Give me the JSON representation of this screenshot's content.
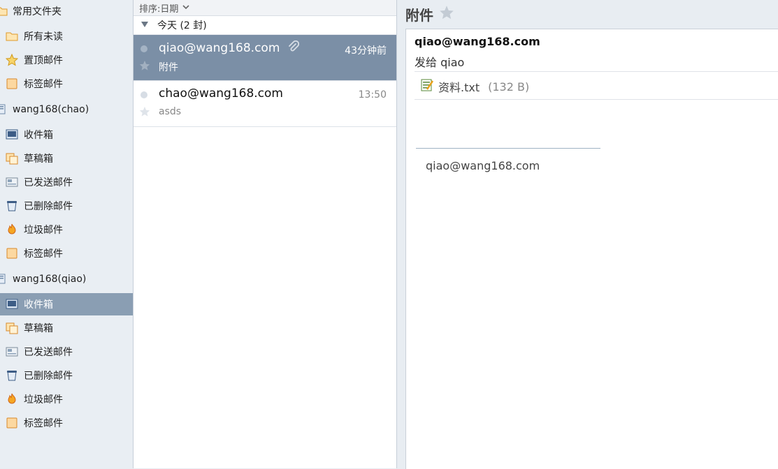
{
  "sidebar": {
    "items": [
      {
        "label": "常用文件夹",
        "icon": "folder-icon",
        "kind": "group"
      },
      {
        "label": "所有未读",
        "icon": "folder-icon",
        "kind": "item"
      },
      {
        "label": "置顶邮件",
        "icon": "star-icon",
        "kind": "item"
      },
      {
        "label": "标签邮件",
        "icon": "tag-icon",
        "kind": "item"
      },
      {
        "label": "wang168(chao)",
        "icon": "account-icon",
        "kind": "group"
      },
      {
        "label": "收件箱",
        "icon": "inbox-icon",
        "kind": "item"
      },
      {
        "label": "草稿箱",
        "icon": "drafts-icon",
        "kind": "item"
      },
      {
        "label": "已发送邮件",
        "icon": "sent-icon",
        "kind": "item"
      },
      {
        "label": "已删除邮件",
        "icon": "trash-icon",
        "kind": "item"
      },
      {
        "label": "垃圾邮件",
        "icon": "spam-icon",
        "kind": "item"
      },
      {
        "label": "标签邮件",
        "icon": "tag-icon",
        "kind": "item"
      },
      {
        "label": "wang168(qiao)",
        "icon": "account-icon",
        "kind": "group"
      },
      {
        "label": "收件箱",
        "icon": "inbox-icon",
        "kind": "item",
        "selected": true
      },
      {
        "label": "草稿箱",
        "icon": "drafts-icon",
        "kind": "item"
      },
      {
        "label": "已发送邮件",
        "icon": "sent-icon",
        "kind": "item"
      },
      {
        "label": "已删除邮件",
        "icon": "trash-icon",
        "kind": "item"
      },
      {
        "label": "垃圾邮件",
        "icon": "spam-icon",
        "kind": "item"
      },
      {
        "label": "标签邮件",
        "icon": "tag-icon",
        "kind": "item"
      }
    ]
  },
  "list": {
    "sort_label": "排序:日期",
    "group_label": "今天 (2 封)",
    "messages": [
      {
        "from": "qiao@wang168.com",
        "subject": "附件",
        "time": "43分钟前",
        "has_attachment": true,
        "selected": true
      },
      {
        "from": "chao@wang168.com",
        "subject": "asds",
        "time": "13:50",
        "has_attachment": false,
        "selected": false
      }
    ]
  },
  "reading": {
    "title": "附件",
    "sender": "qiao@wang168.com",
    "recipient": "发给 qiao",
    "attachment": {
      "name": "资料.txt",
      "size": "(132 B)"
    },
    "signature": "qiao@wang168.com"
  },
  "colors": {
    "selected_sidebar": "#8a9eb3",
    "selected_message": "#7b8fa6",
    "folder_orange": "#f0a030"
  }
}
